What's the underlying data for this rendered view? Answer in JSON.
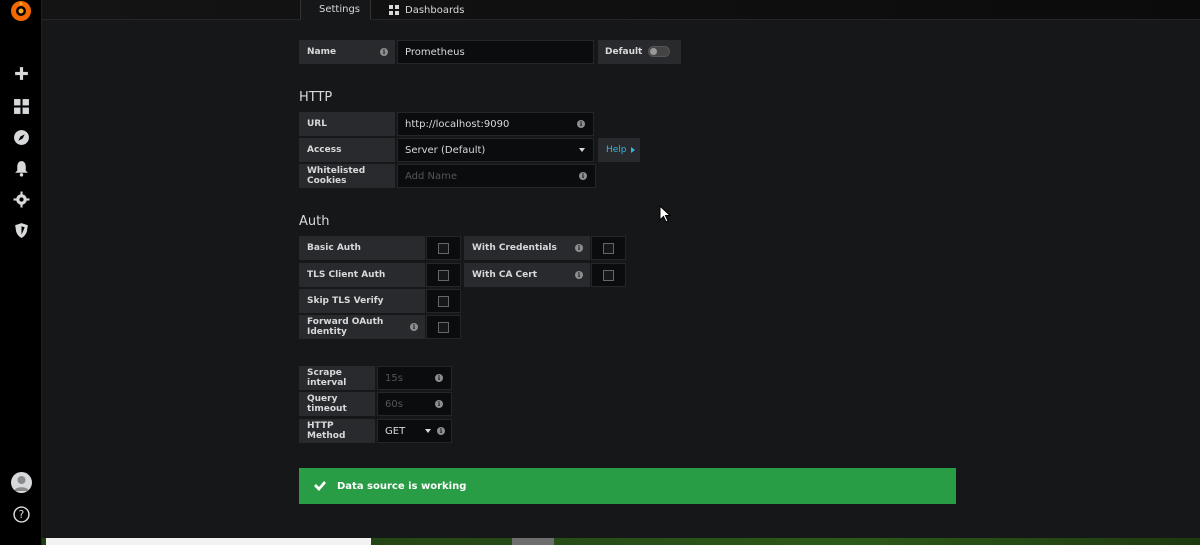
{
  "tabs": [
    {
      "label": "Settings",
      "icon": "sliders-icon",
      "active": true
    },
    {
      "label": "Dashboards",
      "icon": "apps-icon",
      "active": false
    }
  ],
  "name_row": {
    "label": "Name",
    "value": "Prometheus",
    "default_label": "Default",
    "default_on": false
  },
  "http": {
    "title": "HTTP",
    "url_label": "URL",
    "url_value": "http://localhost:9090",
    "access_label": "Access",
    "access_value": "Server (Default)",
    "help_label": "Help",
    "cookies_label": "Whitelisted Cookies",
    "cookies_placeholder": "Add Name"
  },
  "auth": {
    "title": "Auth",
    "basic_auth": "Basic Auth",
    "with_credentials": "With Credentials",
    "tls_client_auth": "TLS Client Auth",
    "with_ca_cert": "With CA Cert",
    "skip_tls_verify": "Skip TLS Verify",
    "forward_oauth": "Forward OAuth Identity"
  },
  "prom": {
    "scrape_label": "Scrape interval",
    "scrape_placeholder": "15s",
    "timeout_label": "Query timeout",
    "timeout_placeholder": "60s",
    "method_label": "HTTP Method",
    "method_value": "GET"
  },
  "alert": {
    "text": "Data source is working",
    "color": "#299c46"
  },
  "colors": {
    "accent_link": "#33b5e5",
    "sidebar_bg": "#000000",
    "page_bg": "#161719"
  }
}
